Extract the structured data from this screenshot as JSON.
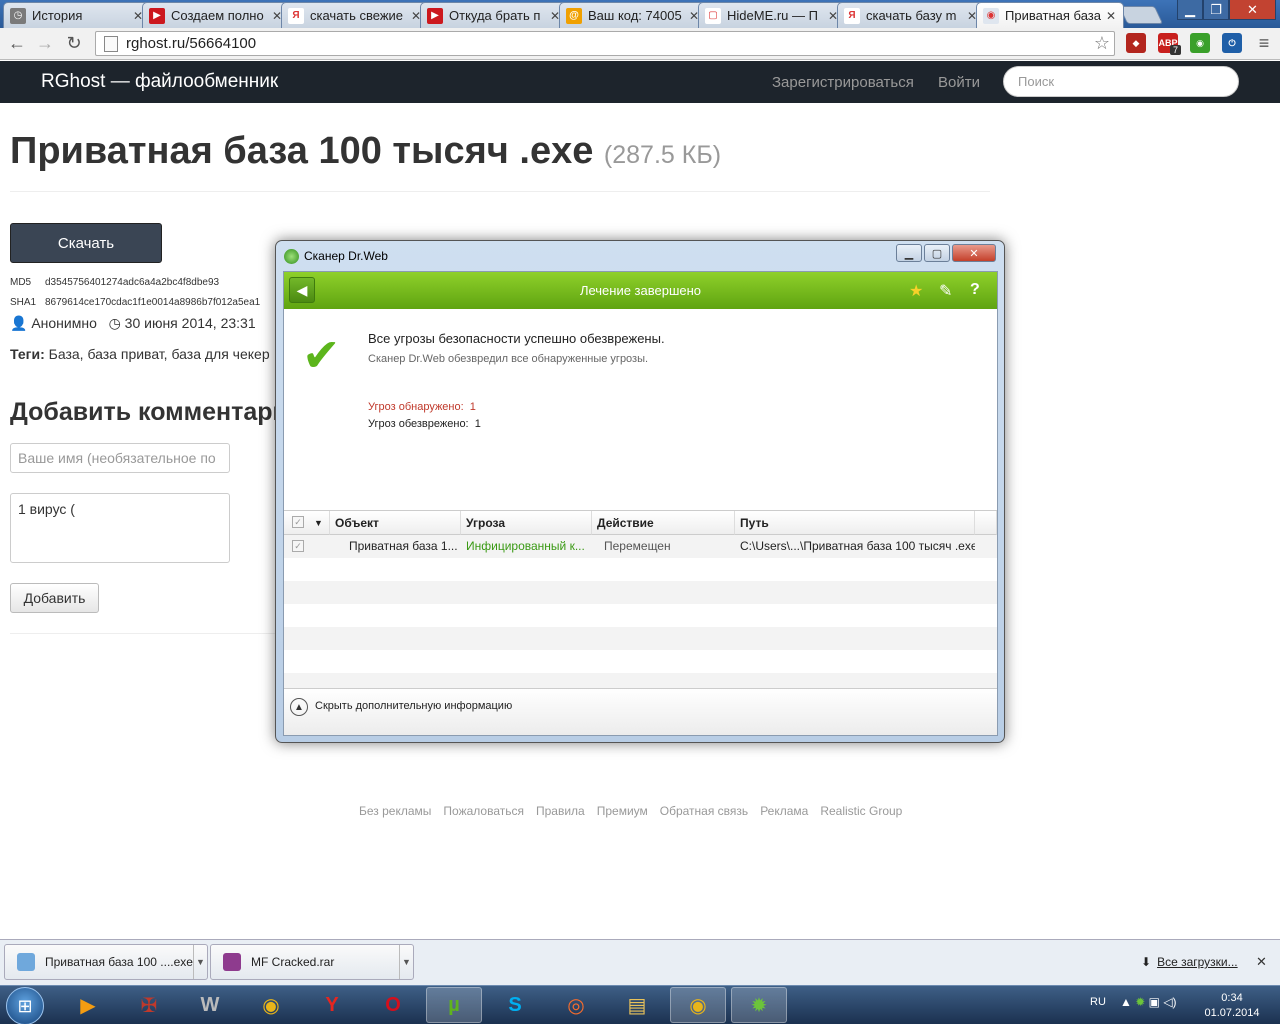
{
  "browser": {
    "tabs": [
      {
        "label": "История",
        "fav_color": "#7a7a7a",
        "fav_glyph": "◷"
      },
      {
        "label": "Создаем полно",
        "fav_color": "#cc181e",
        "fav_glyph": "▶"
      },
      {
        "label": "скачать свежие",
        "fav_color": "#ffffff",
        "fav_glyph": "Я"
      },
      {
        "label": "Откуда брать п",
        "fav_color": "#cc181e",
        "fav_glyph": "▶"
      },
      {
        "label": "Ваш код: 74005",
        "fav_color": "#f0a000",
        "fav_glyph": "@"
      },
      {
        "label": "HideME.ru — П",
        "fav_color": "#ffffff",
        "fav_glyph": "▢"
      },
      {
        "label": "скачать базу m",
        "fav_color": "#ffffff",
        "fav_glyph": "Я"
      },
      {
        "label": "Приватная база",
        "fav_color": "#dfe6ef",
        "fav_glyph": "◉"
      }
    ],
    "active_tab_index": 7,
    "address": "rghost.ru/56664100",
    "extensions": [
      {
        "name": "dota-icon",
        "color": "#b3261e",
        "glyph": "◆"
      },
      {
        "name": "adblock-plus-icon",
        "color": "#c8201e",
        "glyph": "ABP",
        "badge": "7"
      },
      {
        "name": "frog-icon",
        "color": "#3aa02a",
        "glyph": "◉"
      },
      {
        "name": "power-icon",
        "color": "#1f5fa8",
        "glyph": "⏻"
      }
    ]
  },
  "site": {
    "brand": "RGhost — файлообменник",
    "register": "Зарегистрироваться",
    "login": "Войти",
    "search_placeholder": "Поиск"
  },
  "file": {
    "title": "Приватная база 100 тысяч .exe",
    "size": "(287.5 КБ)",
    "download_label": "Скачать",
    "md5_label": "MD5",
    "md5": "d3545756401274adc6a4a2bc4f8dbe93",
    "sha1_label": "SHA1",
    "sha1": "8679614ce170cdac1f1e0014a8986b7f012a5ea1",
    "author": "Анонимно",
    "date": "30 июня 2014, 23:31",
    "tags_label": "Теги:",
    "tags": "База, база приват, база для чекер"
  },
  "comment": {
    "heading": "Добавить комментари",
    "name_placeholder": "Ваше имя (необязательное по",
    "text": "1 вирус (",
    "add_label": "Добавить"
  },
  "footer": {
    "links": [
      "Без рекламы",
      "Пожаловаться",
      "Правила",
      "Премиум",
      "Обратная связь",
      "Реклама",
      "Realistic Group"
    ]
  },
  "drweb": {
    "window_title": "Сканер Dr.Web",
    "status_title": "Лечение завершено",
    "message": "Все угрозы безопасности успешно обезврежены.",
    "submessage": "Сканер Dr.Web обезвредил все обнаруженные угрозы.",
    "detected_label": "Угроз обнаружено:",
    "detected": "1",
    "neutralized_label": "Угроз обезврежено:",
    "neutralized": "1",
    "columns": [
      "Объект",
      "Угроза",
      "Действие",
      "Путь"
    ],
    "rows": [
      {
        "object": "Приватная база 1...",
        "threat": "Инфицированный к...",
        "action": "Перемещен",
        "path": "C:\\Users\\...\\Приватная база 100 тысяч .exe"
      }
    ],
    "collapse_label": "Скрыть дополнительную информацию",
    "threat_color": "#3a9a14",
    "detected_color": "#c0392b"
  },
  "downloads": {
    "items": [
      {
        "label": "Приватная база 100 ....exe",
        "icon_color": "#6fa8dc"
      },
      {
        "label": "MF Cracked.rar",
        "icon_color": "#8e3b8e"
      }
    ],
    "all_label": "Все загрузки..."
  },
  "taskbar": {
    "apps": [
      {
        "name": "media-player-icon",
        "glyph": "▶",
        "color": "#f39c12",
        "active": false
      },
      {
        "name": "tanks-icon",
        "glyph": "✠",
        "color": "#c0392b",
        "active": false
      },
      {
        "name": "world-of-tanks-icon",
        "glyph": "W",
        "color": "#bbbbbb",
        "active": false
      },
      {
        "name": "chrome-icon",
        "glyph": "◉",
        "color": "#e8b51a",
        "active": false
      },
      {
        "name": "yandex-browser-icon",
        "glyph": "Y",
        "color": "#e52620",
        "active": false
      },
      {
        "name": "opera-icon",
        "glyph": "O",
        "color": "#d50f1c",
        "active": false
      },
      {
        "name": "utorrent-icon",
        "glyph": "µ",
        "color": "#5fb31e",
        "active": true
      },
      {
        "name": "skype-icon",
        "glyph": "S",
        "color": "#00aff0",
        "active": false
      },
      {
        "name": "origin-icon",
        "glyph": "◎",
        "color": "#f56c2d",
        "active": false
      },
      {
        "name": "explorer-icon",
        "glyph": "▤",
        "color": "#e8c25a",
        "active": false
      },
      {
        "name": "chrome-active-icon",
        "glyph": "◉",
        "color": "#e8b51a",
        "active": true
      },
      {
        "name": "drweb-icon",
        "glyph": "✹",
        "color": "#6cc43a",
        "active": true
      }
    ],
    "lang": "RU",
    "time": "0:34",
    "date": "01.07.2014"
  }
}
